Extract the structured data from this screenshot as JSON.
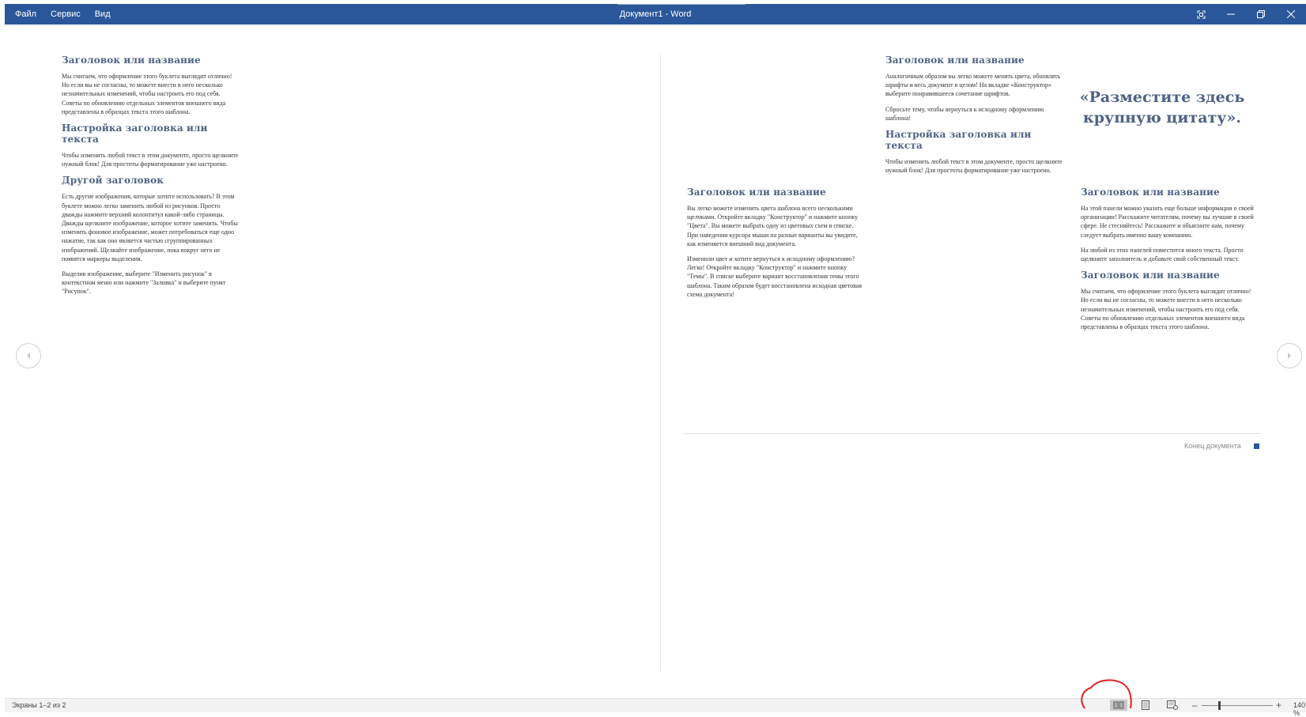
{
  "window": {
    "title": "Документ1  -  Word",
    "menu": [
      "Файл",
      "Сервис",
      "Вид"
    ],
    "controls": [
      "focus-mode-icon",
      "minimize-icon",
      "restore-icon",
      "close-icon"
    ],
    "accent": "#2b579a"
  },
  "page_left": {
    "col1": {
      "h1": "Заголовок или название",
      "p1": "Мы считаем, что оформление этого буклета выглядит отлично! Но если вы не согласны, то можете внести в него несколько незначительных изменений, чтобы настроить его под себя. Советы по обновлению отдельных элементов внешнего вида представлены в образцах текста этого шаблона.",
      "h2": "Настройка заголовка или текста",
      "p2": "Чтобы изменить любой текст в этом документе, просто щелкните нужный блок! Для простоты форматирование уже настроено.",
      "h3": "Другой заголовок",
      "p3": "Есть другие изображения, которые хотите использовать? В этом буклете можно легко заменить любой из рисунков. Просто дважды нажмите верхний колонтитул какой-либо страницы. Дважды щелкните изображение, которое хотите заменить. Чтобы изменить фоновое изображение, может потребоваться еще одно нажатие, так как оно является частью сгруппированных изображений. Щелкайте изображение, пока вокруг него не появятся маркеры выделения.",
      "p4": "Выделив изображение, выберите \"Изменить рисунок\" в контекстном меню или нажмите \"Заливка\" и выберите пункт \"Рисунок\"."
    }
  },
  "page_right": {
    "col1": {
      "h1": "Заголовок или название",
      "p1": "Вы легко можете изменить цвета шаблона всего несколькими щелчками. Откройте вкладку \"Конструктор\" и нажмите кнопку \"Цвета\". Вы можете выбрать одну из цветовых схем в списке. При наведении курсора мыши на разные варианты вы увидите, как изменяется внешний вид документа.",
      "p2": "Изменили цвет и хотите вернуться к исходному оформлению? Легко! Откройте вкладку \"Конструктор\" и нажмите кнопку \"Темы\". В списке выберите вариант восстановления темы этого шаблона. Таким образом будет восстановлена исходная цветовая схема документа!"
    },
    "col2": {
      "h1": "Заголовок или название",
      "p1": "Аналогичным образом вы легко можете менять цвета, обновлять шрифты и весь документ в целом! На вкладке «Конструктор» выберите понравившееся сочетание шрифтов.",
      "p2": "Сбросьте тему, чтобы вернуться к исходному оформлению шаблона!",
      "h2": "Настройка заголовка или текста",
      "p3": "Чтобы изменить любой текст в этом документе, просто щелкните нужный блок! Для простоты форматирование уже настроено."
    },
    "quote": "«Разместите здесь крупную цитату».",
    "col3": {
      "h1": "Заголовок или название",
      "p1": "На этой панели можно указать еще больше информации о своей организации! Расскажите читателям, почему вы лучшие в своей сфере. Не стесняйтесь! Расскажите и объясните нам, почему следует выбрать именно вашу компанию.",
      "p2": "На любой из этих панелей поместится много текста. Просто щелкните заполнитель и добавьте свой собственный текст.",
      "h2": "Заголовок или название",
      "p3": "Мы считаем, что оформление этого буклета выглядит отлично! Но если вы не согласны, то можете внести в него несколько незначительных изменений, чтобы настроить его под себя. Советы по обновлению отдельных элементов внешнего вида представлены в образцах текста этого шаблона."
    },
    "end_of_document": "Конец документа"
  },
  "navigation": {
    "prev_icon": "chevron-left-icon",
    "next_icon": "chevron-right-icon"
  },
  "status": {
    "screens": "Экраны 1–2 из 2",
    "views": [
      "read-mode-icon",
      "print-layout-icon",
      "web-layout-icon"
    ],
    "active_view": "read-mode-icon",
    "zoom_minus": "–",
    "zoom_plus": "+",
    "zoom": "140 %",
    "zoom_level_fraction": 0.21
  },
  "annotation_color": "#e02020"
}
